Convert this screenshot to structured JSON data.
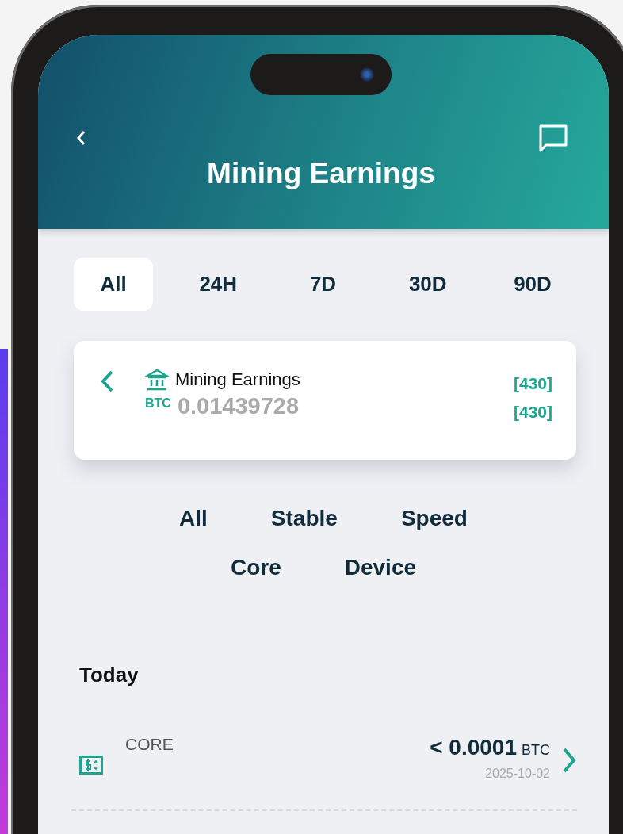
{
  "header": {
    "title": "Mining Earnings"
  },
  "periods": [
    {
      "label": "All",
      "selected": true
    },
    {
      "label": "24H",
      "selected": false
    },
    {
      "label": "7D",
      "selected": false
    },
    {
      "label": "30D",
      "selected": false
    },
    {
      "label": "90D",
      "selected": false
    }
  ],
  "summary": {
    "title": "Mining Earnings",
    "currency": "BTC",
    "amount": "0.01439728",
    "counts": [
      "[430]",
      "[430]"
    ]
  },
  "filters": [
    "All",
    "Stable",
    "Speed",
    "Core",
    "Device"
  ],
  "sections": [
    {
      "heading": "Today",
      "entries": [
        {
          "type": "CORE",
          "amount": "< 0.0001",
          "unit": "BTC",
          "date": "2025-10-02"
        }
      ]
    }
  ]
}
